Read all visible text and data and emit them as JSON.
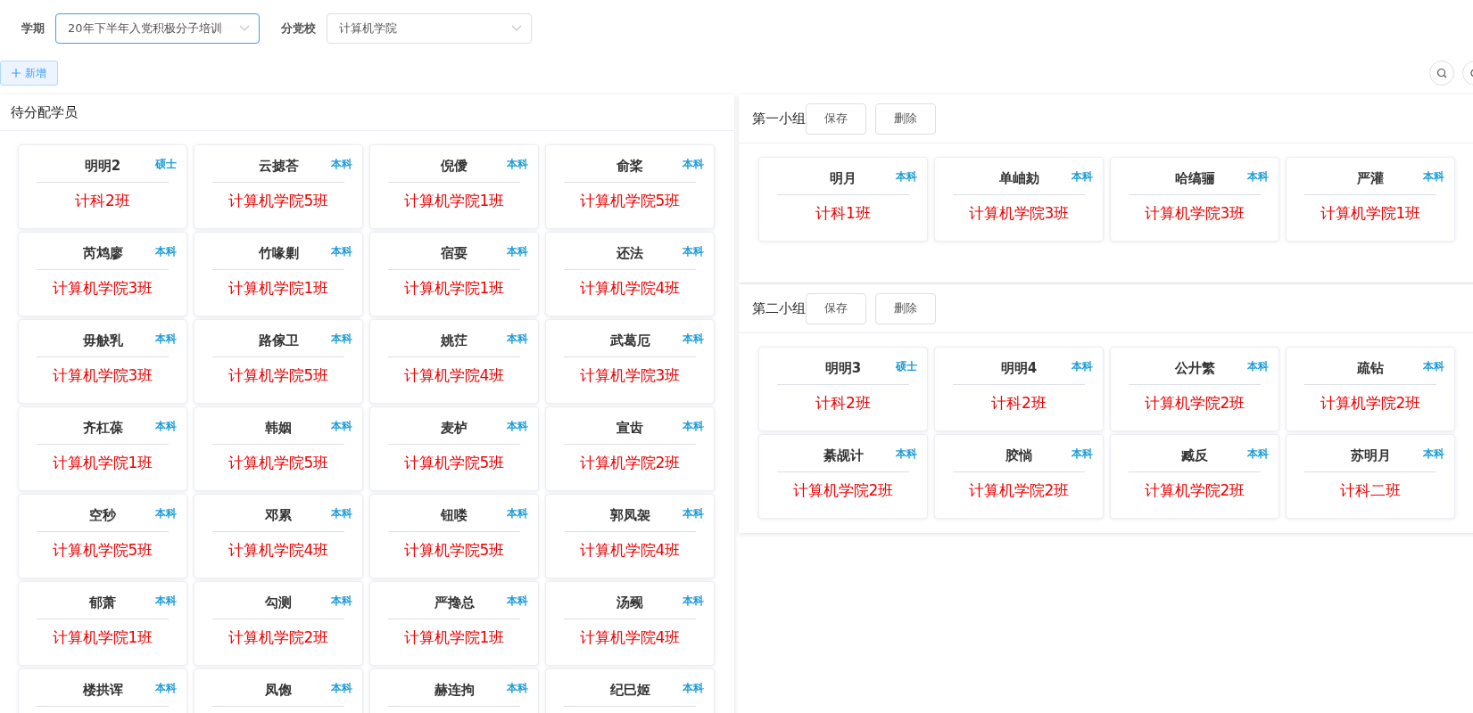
{
  "filters": [
    {
      "label": "学期",
      "value": "20年下半年入党积极分子培训",
      "focused": true
    },
    {
      "label": "分党校",
      "value": "计算机学院",
      "focused": false
    }
  ],
  "add_button": "新增",
  "unassigned": {
    "title": "待分配学员",
    "students": [
      {
        "name": "明明2",
        "degree": "硕士",
        "class": "计科2班"
      },
      {
        "name": "云摅荅",
        "degree": "本科",
        "class": "计算机学院5班"
      },
      {
        "name": "倪僾",
        "degree": "本科",
        "class": "计算机学院1班"
      },
      {
        "name": "俞桨",
        "degree": "本科",
        "class": "计算机学院5班"
      },
      {
        "name": "芮鸩廖",
        "degree": "本科",
        "class": "计算机学院3班"
      },
      {
        "name": "竹喙剿",
        "degree": "本科",
        "class": "计算机学院1班"
      },
      {
        "name": "宿耍",
        "degree": "本科",
        "class": "计算机学院1班"
      },
      {
        "name": "还法",
        "degree": "本科",
        "class": "计算机学院4班"
      },
      {
        "name": "毋觖乳",
        "degree": "本科",
        "class": "计算机学院3班"
      },
      {
        "name": "路傢卫",
        "degree": "本科",
        "class": "计算机学院5班"
      },
      {
        "name": "姚茳",
        "degree": "本科",
        "class": "计算机学院4班"
      },
      {
        "name": "武葛厄",
        "degree": "本科",
        "class": "计算机学院3班"
      },
      {
        "name": "齐杠葆",
        "degree": "本科",
        "class": "计算机学院1班"
      },
      {
        "name": "韩姻",
        "degree": "本科",
        "class": "计算机学院5班"
      },
      {
        "name": "麦栌",
        "degree": "本科",
        "class": "计算机学院5班"
      },
      {
        "name": "宣齿",
        "degree": "本科",
        "class": "计算机学院2班"
      },
      {
        "name": "空秒",
        "degree": "本科",
        "class": "计算机学院5班"
      },
      {
        "name": "邓累",
        "degree": "本科",
        "class": "计算机学院4班"
      },
      {
        "name": "钮喽",
        "degree": "本科",
        "class": "计算机学院5班"
      },
      {
        "name": "郭凤袈",
        "degree": "本科",
        "class": "计算机学院4班"
      },
      {
        "name": "郁萧",
        "degree": "本科",
        "class": "计算机学院1班"
      },
      {
        "name": "勾测",
        "degree": "本科",
        "class": "计算机学院2班"
      },
      {
        "name": "严搀总",
        "degree": "本科",
        "class": "计算机学院1班"
      },
      {
        "name": "汤觋",
        "degree": "本科",
        "class": "计算机学院4班"
      },
      {
        "name": "楼拱诨",
        "degree": "本科"
      },
      {
        "name": "凤偬",
        "degree": "本科"
      },
      {
        "name": "赫连拘",
        "degree": "本科"
      },
      {
        "name": "纪巳姬",
        "degree": "本科"
      }
    ]
  },
  "groups": [
    {
      "title": "第一小组",
      "save": "保存",
      "delete": "删除",
      "students": [
        {
          "name": "明月",
          "degree": "本科",
          "class": "计科1班"
        },
        {
          "name": "单岫劾",
          "degree": "本科",
          "class": "计算机学院3班"
        },
        {
          "name": "哈缟骊",
          "degree": "本科",
          "class": "计算机学院3班"
        },
        {
          "name": "严灌",
          "degree": "本科",
          "class": "计算机学院1班"
        }
      ]
    },
    {
      "title": "第二小组",
      "save": "保存",
      "delete": "删除",
      "students": [
        {
          "name": "明明3",
          "degree": "硕士",
          "class": "计科2班"
        },
        {
          "name": "明明4",
          "degree": "本科",
          "class": "计科2班"
        },
        {
          "name": "公廾繁",
          "degree": "本科",
          "class": "计算机学院2班"
        },
        {
          "name": "疏钻",
          "degree": "本科",
          "class": "计算机学院2班"
        },
        {
          "name": "綦觇计",
          "degree": "本科",
          "class": "计算机学院2班"
        },
        {
          "name": "胶惝",
          "degree": "本科",
          "class": "计算机学院2班"
        },
        {
          "name": "臧反",
          "degree": "本科",
          "class": "计算机学院2班"
        },
        {
          "name": "苏明月",
          "degree": "本科",
          "class": "计科二班"
        }
      ]
    }
  ]
}
